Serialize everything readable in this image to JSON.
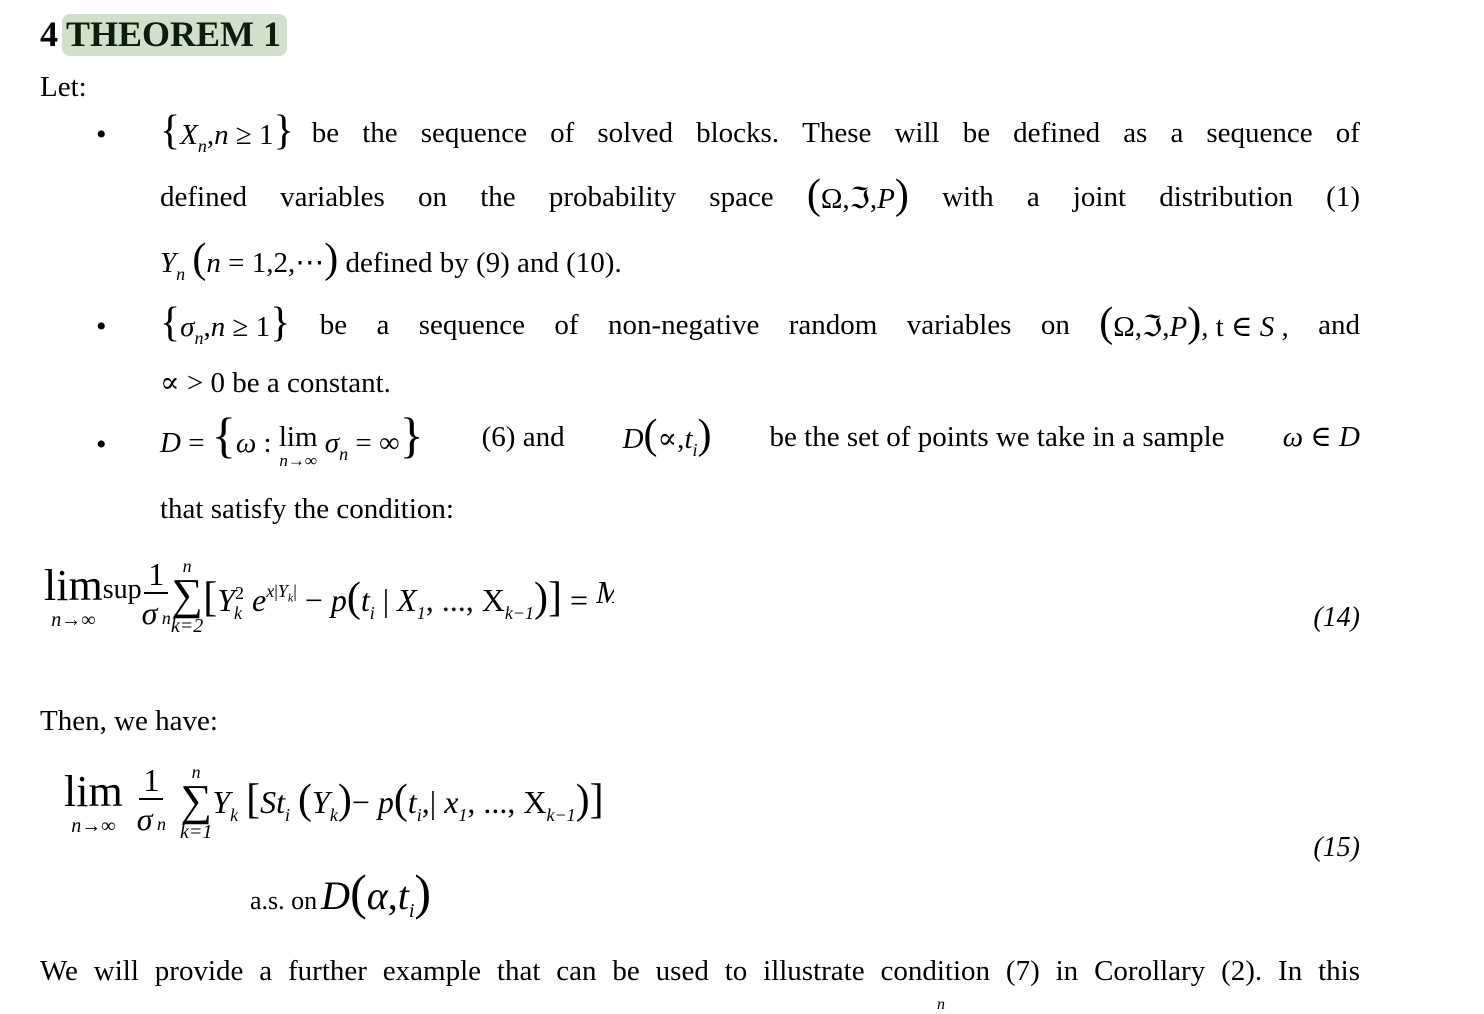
{
  "section": {
    "number": "4",
    "title": "THEOREM 1",
    "highlight_color": "#cfe0cb"
  },
  "intro": "Let:",
  "bullets": [
    {
      "lines": [
        {
          "math": "{X_n, n ≥ 1}",
          "text": "be the sequence of solved blocks. These will be defined as a sequence of"
        },
        {
          "text_a": "defined variables on the probability space",
          "math": "(Ω,ℑ,P)",
          "text_b": "with a joint distribution (1)"
        },
        {
          "math": "Y_n (n = 1,2,⋯)",
          "text": "defined by (9) and (10)."
        }
      ]
    },
    {
      "lines": [
        {
          "math": "{σ_n, n ≥ 1}",
          "text_a": "be a sequence of non-negative random variables on",
          "math_b": "(Ω,ℑ,P)",
          "text_b": ", t ∈ S , and"
        },
        {
          "math": "∝ > 0",
          "text": "be a constant."
        }
      ]
    },
    {
      "lines": [
        {
          "math": "D = {ω : lim_{n→∞} σ_n = ∞}",
          "text_a": "(6) and",
          "math_b": "D(∝, t_i)",
          "text_b": "be the set of points we take in a sample",
          "math_c": "ω ∈ D"
        },
        {
          "text": "that satisfy the condition:"
        }
      ]
    }
  ],
  "equation_14": {
    "latex": "lim_{n→∞} sup (1/σ_n) Σ_{k=2}^{n} [Y_k^2 e^{x|Y_k|} − p(t_i | X_1, ..., X_{k−1})] = M",
    "number": "(14)"
  },
  "then_text": "Then, we have:",
  "equation_15": {
    "latex": "lim_{n→∞} (1/σ_n) Σ_{k=1}^{n} Y_k [St_i(Y_k) − p(t_i, | x_1, ..., X_{k−1})]",
    "suffix_text": "a.s. on",
    "suffix_math": "D(α, t_i)",
    "number": "(15)"
  },
  "closing_paragraph": "We will provide a further example that can be used to illustrate condition (7) in Corollary (2). In this",
  "trailing_fragment": "n"
}
